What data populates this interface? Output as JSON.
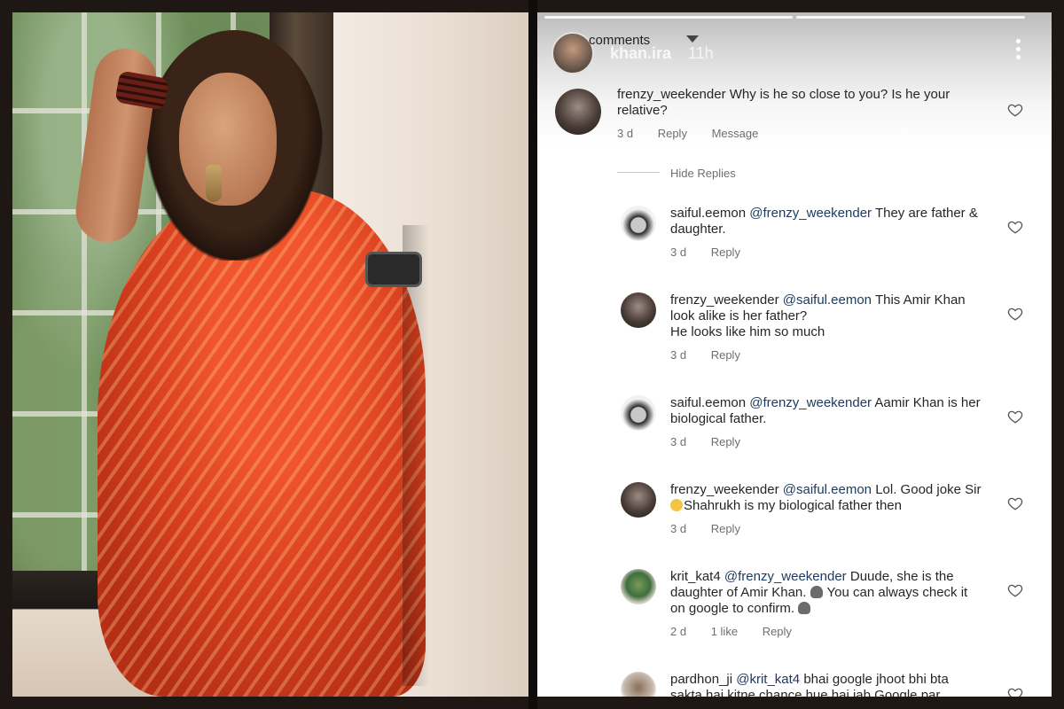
{
  "header": {
    "title": "comments",
    "username": "khan.ira",
    "time": "11h"
  },
  "comments": [
    {
      "user": "frenzy_weekender",
      "text": "Why is he so close to you? Is he your",
      "text2": "relative?",
      "age": "3 d",
      "reply": "Reply",
      "message": "Message"
    }
  ],
  "hide_replies": "Hide Replies",
  "replies": [
    {
      "user": "saiful.eemon",
      "mention": "@frenzy_weekender",
      "text": "They are father &",
      "text2": "daughter.",
      "age": "3 d",
      "reply": "Reply"
    },
    {
      "user": "frenzy_weekender",
      "mention": "@saiful.eemon",
      "text": "This Amir Khan",
      "text2": "look alike is her father?",
      "text3": "He looks like him so much",
      "age": "3 d",
      "reply": "Reply"
    },
    {
      "user": "saiful.eemon",
      "mention": "@frenzy_weekender",
      "text": "Aamir Khan is her",
      "text2": "biological father.",
      "age": "3 d",
      "reply": "Reply"
    },
    {
      "user": "frenzy_weekender",
      "mention": "@saiful.eemon",
      "text": "Lol. Good joke Sir",
      "text2": "Shahrukh is my biological father then",
      "age": "3 d",
      "reply": "Reply"
    },
    {
      "user": "krit_kat4",
      "mention": "@frenzy_weekender",
      "text": "Duude, she is the",
      "text2": "daughter of Amir Khan.",
      "text2b": "You can always check it",
      "text3": "on google to confirm.",
      "age": "2 d",
      "likes": "1 like",
      "reply": "Reply"
    },
    {
      "user": "pardhon_ji",
      "mention": "@krit_kat4",
      "text": "bhai google jhoot bhi bta",
      "text2": "sakta hai kitne chance hue hai jab Google par"
    }
  ],
  "icons": {
    "heart": "heart-outline-icon",
    "more": "more-vertical-icon",
    "caret": "chevron-down-icon"
  }
}
